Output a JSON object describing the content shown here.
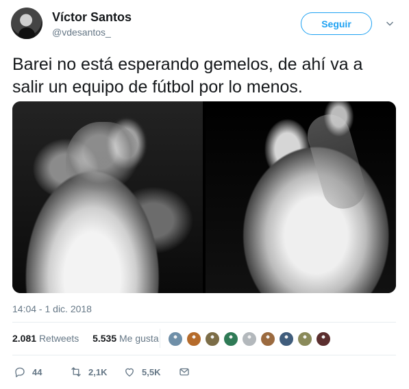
{
  "author": {
    "name": "Víctor Santos",
    "handle": "@vdesantos_"
  },
  "follow_button": {
    "label": "Seguir"
  },
  "tweet": {
    "text": "Barei no está esperando gemelos, de ahí va a salir un equipo de fútbol por lo menos.",
    "timestamp": "14:04 - 1 dic. 2018"
  },
  "stats": {
    "retweets_count": "2.081",
    "retweets_label": "Retweets",
    "likes_count": "5.535",
    "likes_label": "Me gusta"
  },
  "likers": [
    {
      "color": "#6f8fa8"
    },
    {
      "color": "#b56b2b"
    },
    {
      "color": "#7c6d47"
    },
    {
      "color": "#2f7a56"
    },
    {
      "color": "#b3b8bc"
    },
    {
      "color": "#9b6a3f"
    },
    {
      "color": "#405d7c"
    },
    {
      "color": "#8a8a5a"
    },
    {
      "color": "#5b2e2e"
    }
  ],
  "actions": {
    "reply": "44",
    "retweet": "2,1K",
    "like": "5,5K"
  },
  "icons": {
    "more": "chevron-down-icon",
    "reply": "reply-icon",
    "retweet": "retweet-icon",
    "like": "heart-icon",
    "dm": "envelope-icon"
  }
}
